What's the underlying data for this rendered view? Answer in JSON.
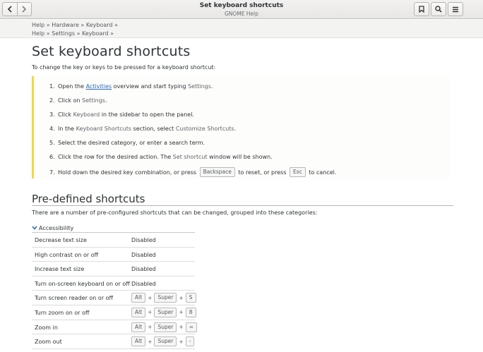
{
  "header": {
    "title": "Set keyboard shortcuts",
    "subtitle": "GNOME Help"
  },
  "breadcrumbs": [
    {
      "parts": [
        "Help",
        "Hardware",
        "Keyboard"
      ]
    },
    {
      "parts": [
        "Help",
        "Settings",
        "Keyboard"
      ]
    }
  ],
  "page": {
    "title": "Set keyboard shortcuts",
    "intro": "To change the key or keys to be pressed for a keyboard shortcut:"
  },
  "steps": {
    "s1": {
      "num": "1.",
      "a": "Open the ",
      "link": "Activities",
      "b": " overview and start typing ",
      "gui": "Settings",
      "c": "."
    },
    "s2": {
      "num": "2.",
      "a": "Click on ",
      "gui": "Settings",
      "c": "."
    },
    "s3": {
      "num": "3.",
      "a": "Click ",
      "gui": "Keyboard",
      "c": " in the sidebar to open the panel."
    },
    "s4": {
      "num": "4.",
      "a": "In the ",
      "gui1": "Keyboard Shortcuts",
      "b": " section, select ",
      "gui2": "Customize Shortcuts",
      "c": "."
    },
    "s5": {
      "num": "5.",
      "a": "Select the desired category, or enter a search term."
    },
    "s6": {
      "num": "6.",
      "a": "Click the row for the desired action. The ",
      "gui": "Set shortcut",
      "c": " window will be shown."
    },
    "s7": {
      "num": "7.",
      "a": "Hold down the desired key combination, or press ",
      "key1": "Backspace",
      "b": " to reset, or press ",
      "key2": "Esc",
      "c": " to cancel."
    }
  },
  "predefined": {
    "title": "Pre-defined shortcuts",
    "intro": "There are a number of pre-configured shortcuts that can be changed, grouped into these categories:",
    "group_label": "Accessibility",
    "plus": "+",
    "rows": [
      {
        "name": "Decrease text size",
        "value": "Disabled"
      },
      {
        "name": "High contrast on or off",
        "value": "Disabled"
      },
      {
        "name": "Increase text size",
        "value": "Disabled"
      },
      {
        "name": "Turn on-screen keyboard on or off",
        "value": "Disabled"
      },
      {
        "name": "Turn screen reader on or off",
        "keys": [
          "Alt",
          "Super",
          "S"
        ]
      },
      {
        "name": "Turn zoom on or off",
        "keys": [
          "Alt",
          "Super",
          "8"
        ]
      },
      {
        "name": "Zoom in",
        "keys": [
          "Alt",
          "Super",
          "="
        ]
      },
      {
        "name": "Zoom out",
        "keys": [
          "Alt",
          "Super",
          "-"
        ]
      }
    ]
  },
  "icons": {
    "back": "go-previous-icon",
    "forward": "go-next-icon",
    "bookmark": "bookmark-icon",
    "search": "search-icon",
    "menu": "hamburger-menu-icon",
    "expander": "chevron-down-icon"
  },
  "colors": {
    "link": "#2a6bb5",
    "note_border": "#f5d545",
    "chevron": "#2a6bb5"
  }
}
